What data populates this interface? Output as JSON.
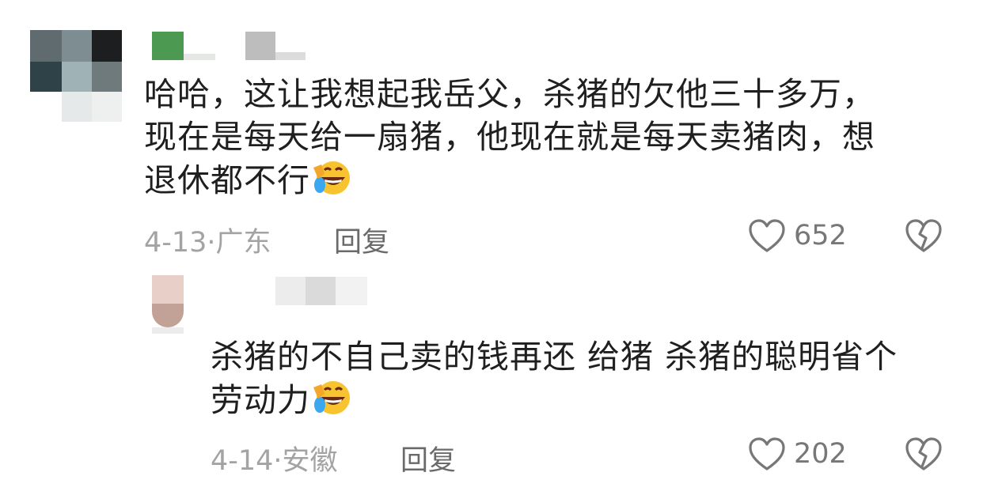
{
  "comments": [
    {
      "text_lines": [
        "哈哈，这让我想起我岳父，杀猪的欠他三十多万，",
        "现在是每天给一扇猪，他现在就是每天卖猪肉，想",
        "退休都不行"
      ],
      "emoji": "laughing-crying-emoji",
      "date_location": "4-13·广东",
      "reply_label": "回复",
      "like_count": "652"
    }
  ],
  "replies": [
    {
      "text_lines": [
        "杀猪的不自己卖的钱再还 给猪 杀猪的聪明省个",
        "劳动力"
      ],
      "emoji": "laughing-crying-emoji",
      "date_location": "4-14·安徽",
      "reply_label": "回复",
      "like_count": "202"
    }
  ],
  "icons": {
    "like": "heart-outline-icon",
    "dislike": "broken-heart-icon"
  },
  "colors": {
    "text": "#1f1f1f",
    "meta": "#a3a3a3",
    "reply": "#6a6a6a",
    "icon": "#777777"
  }
}
